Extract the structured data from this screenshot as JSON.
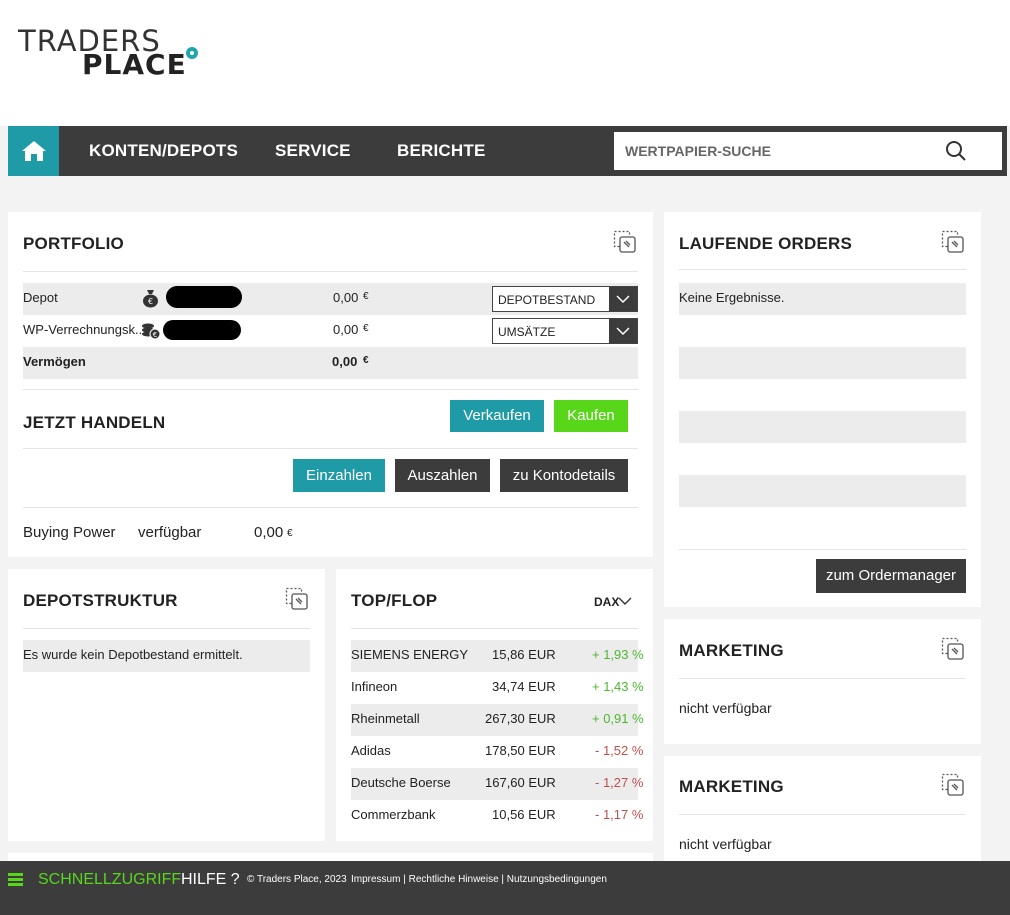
{
  "brand": {
    "line1": "TRADERS",
    "line2": "PLACE"
  },
  "nav": {
    "items": [
      "KONTEN/DEPOTS",
      "SERVICE",
      "BERICHTE"
    ],
    "search_placeholder": "WERTPAPIER-SUCHE"
  },
  "portfolio": {
    "title": "PORTFOLIO",
    "rows": [
      {
        "label": "Depot",
        "value": "0,00",
        "currency": "€",
        "select": "DEPOTBESTAND"
      },
      {
        "label": "WP-Verrechnungsk...",
        "value": "0,00",
        "currency": "€",
        "select": "UMSÄTZE"
      }
    ],
    "total": {
      "label": "Vermögen",
      "value": "0,00",
      "currency": "€"
    }
  },
  "trade": {
    "title": "JETZT HANDELN",
    "sell": "Verkaufen",
    "buy": "Kaufen",
    "deposit": "Einzahlen",
    "withdraw": "Auszahlen",
    "account_details": "zu Kontodetails",
    "buying_power": {
      "label": "Buying Power",
      "sub": "verfügbar",
      "value": "0,00",
      "currency": "€"
    }
  },
  "depotstruktur": {
    "title": "DEPOTSTRUKTUR",
    "empty": "Es wurde kein Depotbestand ermittelt."
  },
  "topflop": {
    "title": "TOP/FLOP",
    "index": "DAX",
    "rows": [
      {
        "name": "SIEMENS ENERGY",
        "price": "15,86 EUR",
        "change": "+ 1,93 %",
        "dir": "up"
      },
      {
        "name": "Infineon",
        "price": "34,74 EUR",
        "change": "+ 1,43 %",
        "dir": "up"
      },
      {
        "name": "Rheinmetall",
        "price": "267,30 EUR",
        "change": "+ 0,91 %",
        "dir": "up"
      },
      {
        "name": "Adidas",
        "price": "178,50 EUR",
        "change": "- 1,52 %",
        "dir": "down"
      },
      {
        "name": "Deutsche Boerse",
        "price": "167,60 EUR",
        "change": "- 1,27 %",
        "dir": "down"
      },
      {
        "name": "Commerzbank",
        "price": "10,56 EUR",
        "change": "- 1,17 %",
        "dir": "down"
      }
    ],
    "colors": {
      "up": "#4cb82e",
      "down": "#c0504d"
    }
  },
  "orders": {
    "title": "LAUFENDE ORDERS",
    "empty": "Keine Ergebnisse.",
    "button": "zum Ordermanager"
  },
  "marketing": [
    {
      "title": "MARKETING",
      "text": "nicht verfügbar"
    },
    {
      "title": "MARKETING",
      "text": "nicht verfügbar"
    }
  ],
  "footer": {
    "quick": "SCHNELLZUGRIFF",
    "help": "HILFE ?",
    "copyright": "© Traders Place, 2023",
    "links": "Impressum | Rechtliche Hinweise | Nutzungsbedingungen"
  },
  "colors": {
    "teal": "#1e9ba6",
    "green": "#57d61a",
    "dark": "#3c3c3c"
  }
}
